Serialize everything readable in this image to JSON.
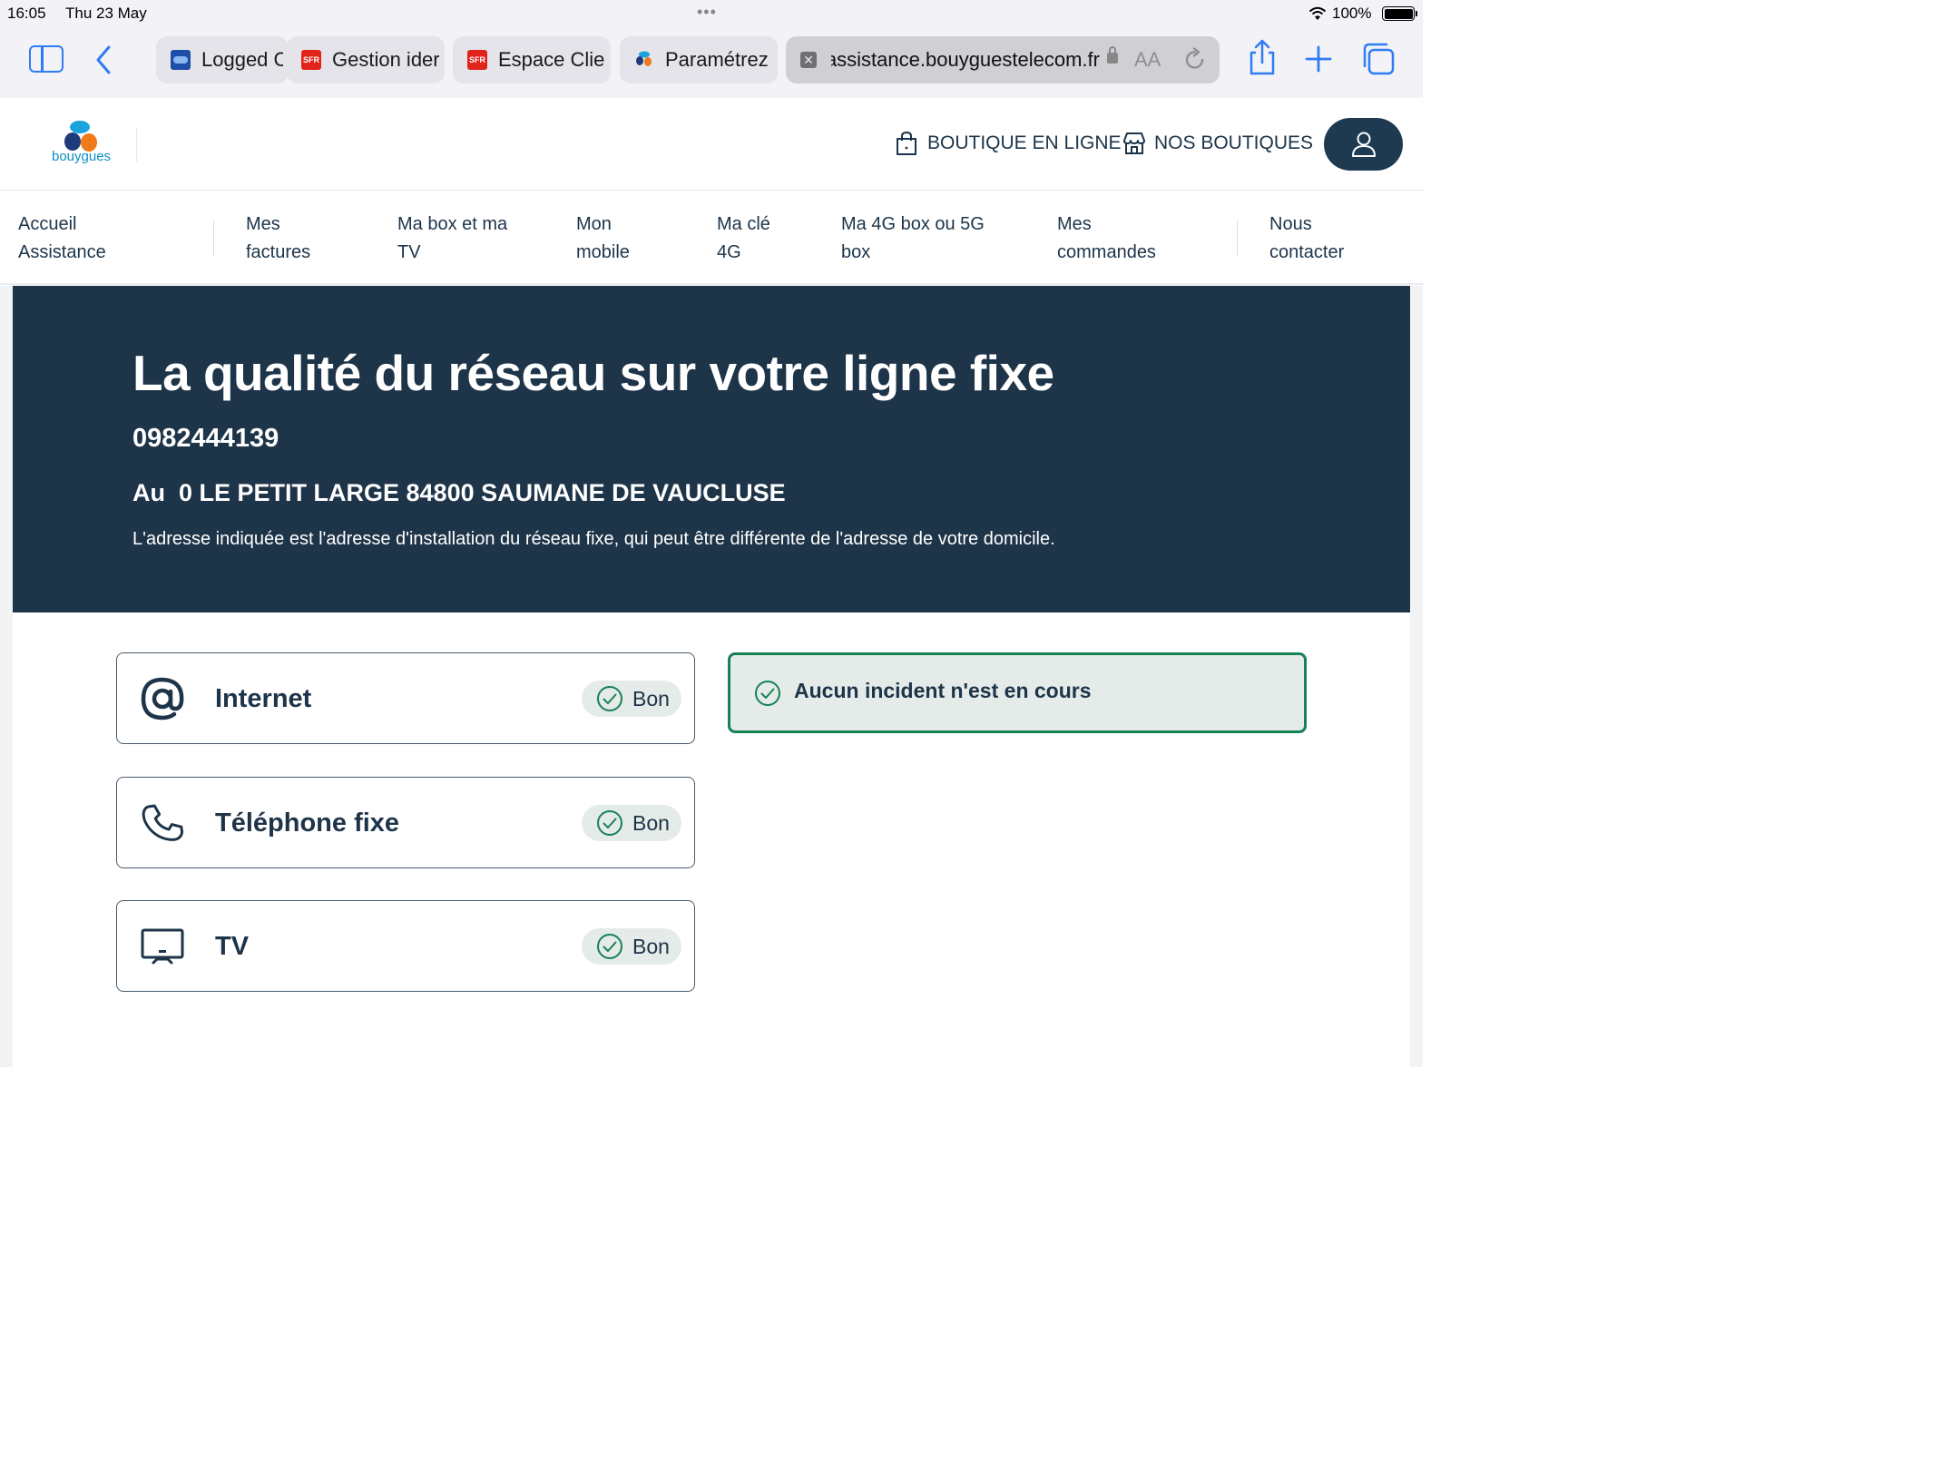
{
  "status_bar": {
    "time": "16:05",
    "date": "Thu 23 May",
    "battery": "100%"
  },
  "browser": {
    "tabs": [
      {
        "label": "Logged C",
        "favicon": "logged-favicon"
      },
      {
        "label": "Gestion ider",
        "favicon": "sfr-favicon"
      },
      {
        "label": "Espace Clie",
        "favicon": "sfr-favicon"
      },
      {
        "label": "Paramétrez",
        "favicon": "bouygues-favicon"
      }
    ],
    "url": "assistance.bouyguestelecom.fr",
    "reader_label": "AA"
  },
  "header": {
    "logo_text": "bouygues",
    "shop_online": "BOUTIQUE EN LIGNE",
    "our_shops": "NOS BOUTIQUES"
  },
  "nav": {
    "items": [
      {
        "line1": "Accueil",
        "line2": "Assistance"
      },
      {
        "line1": "Mes",
        "line2": "factures"
      },
      {
        "line1": "Ma box et ma",
        "line2": "TV"
      },
      {
        "line1": "Mon",
        "line2": "mobile"
      },
      {
        "line1": "Ma clé",
        "line2": "4G"
      },
      {
        "line1": "Ma 4G box ou 5G",
        "line2": "box"
      },
      {
        "line1": "Mes",
        "line2": "commandes"
      },
      {
        "line1": "Nous",
        "line2": "contacter"
      }
    ]
  },
  "hero": {
    "title": "La qualité du réseau sur votre ligne fixe",
    "phone": "0982444139",
    "address": "Au  0 LE PETIT LARGE 84800 SAUMANE DE VAUCLUSE",
    "note": "L'adresse indiquée est l'adresse d'installation du réseau fixe, qui peut être différente de l'adresse de votre domicile."
  },
  "services": [
    {
      "name": "Internet",
      "status": "Bon",
      "icon": "at-icon"
    },
    {
      "name": "Téléphone fixe",
      "status": "Bon",
      "icon": "phone-icon"
    },
    {
      "name": "TV",
      "status": "Bon",
      "icon": "tv-icon"
    }
  ],
  "incident": {
    "message": "Aucun incident n'est en cours"
  },
  "colors": {
    "navy": "#1e3449",
    "accent_blue": "#2f7cf6",
    "ok_green": "#168256",
    "badge_bg": "#e5ebe8"
  }
}
